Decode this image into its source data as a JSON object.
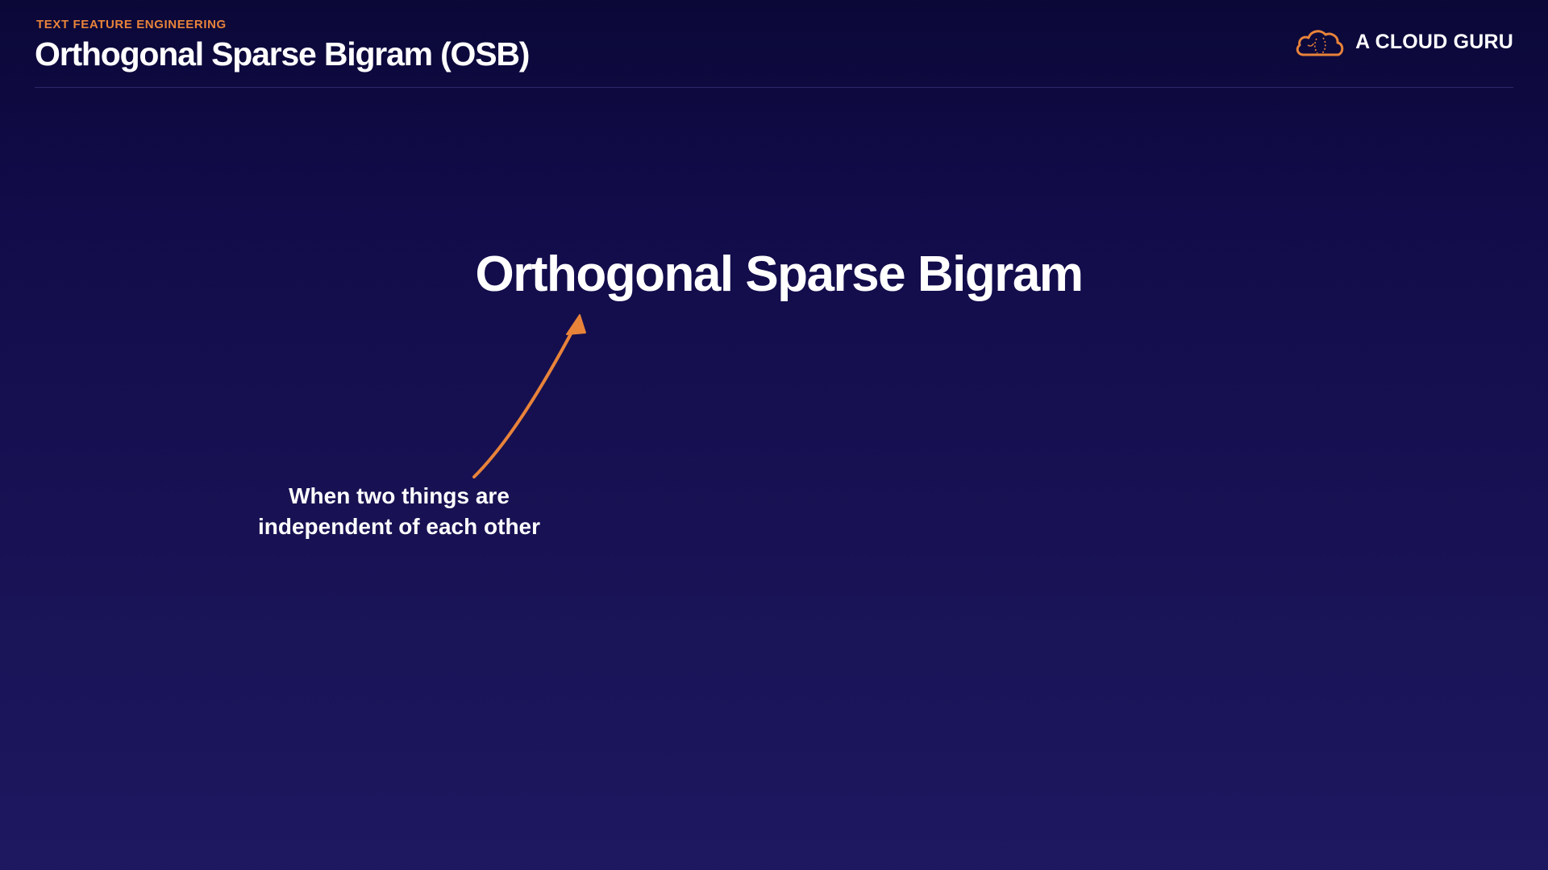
{
  "header": {
    "section": "TEXT FEATURE ENGINEERING",
    "title": "Orthogonal Sparse Bigram (OSB)"
  },
  "brand": {
    "name": "A CLOUD GURU",
    "logo_icon": "cloud-logo-icon",
    "logo_color": "#e8833a"
  },
  "main": {
    "heading": "Orthogonal Sparse Bigram",
    "annotation": {
      "line1": "When two things are",
      "line2": "independent of each other"
    },
    "arrow_icon": "hand-drawn-arrow-icon",
    "arrow_color": "#e8833a"
  },
  "colors": {
    "accent": "#e8833a",
    "background_top": "#0b0838",
    "background_bottom": "#1d1860",
    "text": "#ffffff"
  }
}
